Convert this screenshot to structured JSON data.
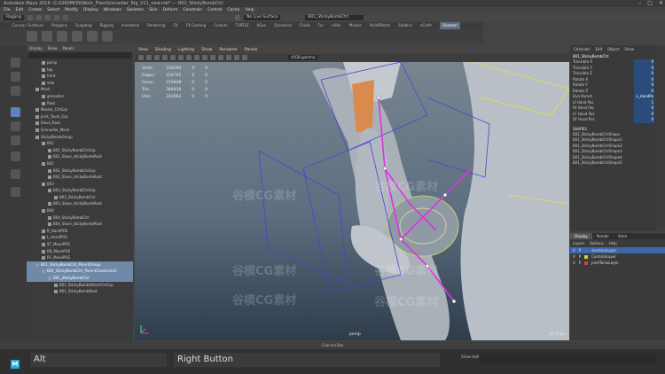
{
  "window": {
    "title": "Autodesk Maya 2016: G:\\GNOMON\\Work_Files\\Grenadier_Rig_V11_new.mb* --- B01_StickyBombCtrl"
  },
  "menubar": [
    "File",
    "Edit",
    "Create",
    "Select",
    "Modify",
    "Display",
    "Windows",
    "Skeleton",
    "Skin",
    "Deform",
    "Constrain",
    "Control",
    "Cache",
    "Help"
  ],
  "status": {
    "mode": "Rigging",
    "live": "No Live Surface",
    "object": "B01_StickyBombCtrl"
  },
  "shelf": {
    "tabs": [
      "Curves / Surfaces",
      "Polygons",
      "Sculpting",
      "Rigging",
      "Animation",
      "Rendering",
      "FX",
      "FX Caching",
      "Custom",
      "TURTLE",
      "XGen",
      "Dynamics",
      "Fluids",
      "Fur",
      "nHair",
      "Muscle",
      "PaintEffects",
      "Subdivs",
      "nCloth",
      "Gnomon"
    ],
    "active": "Gnomon"
  },
  "outliner": {
    "menu": [
      "Display",
      "Show",
      "Panels"
    ],
    "items": [
      {
        "label": "persp",
        "level": 2,
        "sel": false
      },
      {
        "label": "top",
        "level": 2,
        "sel": false
      },
      {
        "label": "front",
        "level": 2,
        "sel": false
      },
      {
        "label": "side",
        "level": 2,
        "sel": false
      },
      {
        "label": "Mesh",
        "level": 1,
        "sel": false
      },
      {
        "label": "grenadier",
        "level": 2,
        "sel": false
      },
      {
        "label": "Root",
        "level": 2,
        "sel": false
      },
      {
        "label": "Master_CtrlGrp",
        "level": 1,
        "sel": false
      },
      {
        "label": "Joint_Toum_Grp",
        "level": 1,
        "sel": false
      },
      {
        "label": "Slave_Root",
        "level": 1,
        "sel": false
      },
      {
        "label": "Grenadier_Mesh",
        "level": 1,
        "sel": false
      },
      {
        "label": "StickyBombGroup",
        "level": 1,
        "sel": false
      },
      {
        "label": "B01",
        "level": 2,
        "sel": false
      },
      {
        "label": "B01_StickyBombCtrlGrp",
        "level": 3,
        "sel": false
      },
      {
        "label": "B01_Slave_stickyBombRoot",
        "level": 3,
        "sel": false
      },
      {
        "label": "B02",
        "level": 2,
        "sel": false
      },
      {
        "label": "B02_StickyBombCtrlGrp",
        "level": 3,
        "sel": false
      },
      {
        "label": "B02_Slave_stickyBombRoot",
        "level": 3,
        "sel": false
      },
      {
        "label": "B03",
        "level": 2,
        "sel": false
      },
      {
        "label": "B03_StickyBombCtrlGrp",
        "level": 3,
        "sel": false
      },
      {
        "label": "B03_StickyBombCtrl",
        "level": 4,
        "sel": false
      },
      {
        "label": "B03_Slave_stickyBombRoot",
        "level": 3,
        "sel": false
      },
      {
        "label": "B04",
        "level": 2,
        "sel": false
      },
      {
        "label": "B04_StickyBombCtrl",
        "level": 3,
        "sel": false
      },
      {
        "label": "B04_Slave_stickyBombRoot",
        "level": 3,
        "sel": false
      },
      {
        "label": "R_HandPOS",
        "level": 2,
        "sel": false
      },
      {
        "label": "L_HandPOS",
        "level": 2,
        "sel": false
      },
      {
        "label": "ST_MovePOS",
        "level": 2,
        "sel": false
      },
      {
        "label": "RB_MovePOS",
        "level": 2,
        "sel": false
      },
      {
        "label": "RF_MovePOS",
        "level": 2,
        "sel": false
      },
      {
        "label": "B01_StickyBombCtrl_ParentGroup",
        "level": 1,
        "sel": true
      },
      {
        "label": "B01_StickyBombCtrl_ParentConstraint1",
        "level": 2,
        "sel": true
      },
      {
        "label": "B01_StickyBombCtrl",
        "level": 3,
        "sel": true
      },
      {
        "label": "B01_StickyBombAttachCtrlGrp",
        "level": 4,
        "sel": false
      },
      {
        "label": "B01_StickyBombRoot",
        "level": 4,
        "sel": false
      }
    ]
  },
  "viewport": {
    "menu": [
      "View",
      "Shading",
      "Lighting",
      "Show",
      "Renderer",
      "Panels"
    ],
    "camera_field": "sRGB gamma",
    "hud": [
      {
        "label": "Verts:",
        "a": "218394",
        "b": "0",
        "c": "0"
      },
      {
        "label": "Edges:",
        "a": "434795",
        "b": "0",
        "c": "0"
      },
      {
        "label": "Faces:",
        "a": "219848",
        "b": "0",
        "c": "0"
      },
      {
        "label": "Tris:",
        "a": "384818",
        "b": "0",
        "c": "0"
      },
      {
        "label": "UVs:",
        "a": "243062",
        "b": "0",
        "c": "0"
      }
    ],
    "camera": "persp",
    "fps": "37.5 fps",
    "watermarks": [
      "谷模CG素材",
      "谷模CG素材",
      "谷模CG素材",
      "谷模CG素材",
      "谷模CG素材",
      "谷模CG素材"
    ]
  },
  "channel_box": {
    "menu": [
      "Channels",
      "Edit",
      "Object",
      "Show"
    ],
    "object": "B01_StickyBombCtrl",
    "channels": [
      {
        "name": "Translate X",
        "value": "0"
      },
      {
        "name": "Translate Y",
        "value": "0"
      },
      {
        "name": "Translate Z",
        "value": "0"
      },
      {
        "name": "Rotate X",
        "value": "0"
      },
      {
        "name": "Rotate Y",
        "value": "0"
      },
      {
        "name": "Rotate Z",
        "value": "0"
      },
      {
        "name": "Dyn Parent",
        "value": "L_HandPa"
      },
      {
        "name": "Lf Hand Pos",
        "value": "1"
      },
      {
        "name": "Rt Hand Pos",
        "value": "0"
      },
      {
        "name": "LF Hand Pos",
        "value": "0"
      },
      {
        "name": "SF Hand Pos",
        "value": "0"
      }
    ],
    "shapes_title": "SHAPES",
    "shapes": [
      "B01_StickyBombCtrlShape",
      "B01_StickyBombCtrlShape1",
      "B01_StickyBombCtrlShape2",
      "B01_StickyBombCtrlShape3",
      "B01_StickyBombCtrlShape4",
      "B01_StickyBombCtrlShape5"
    ]
  },
  "layers": {
    "tabs": [
      "Display",
      "Render",
      "Anim"
    ],
    "active": "Display",
    "menu": [
      "Layers",
      "Options",
      "Help"
    ],
    "items": [
      {
        "name": "skeletonLayer",
        "color": "#3d6bd8",
        "sel": true
      },
      {
        "name": "ControlsLayer",
        "color": "#d8d23d",
        "sel": false
      },
      {
        "name": "JointTorsoLayer",
        "color": "#d83d3d",
        "sel": false
      }
    ]
  },
  "timeslider": {
    "label": "Channel Box"
  },
  "command": {
    "alt": "Alt",
    "right": "Right Button",
    "hotkey_label": "Show Hotkeys"
  }
}
